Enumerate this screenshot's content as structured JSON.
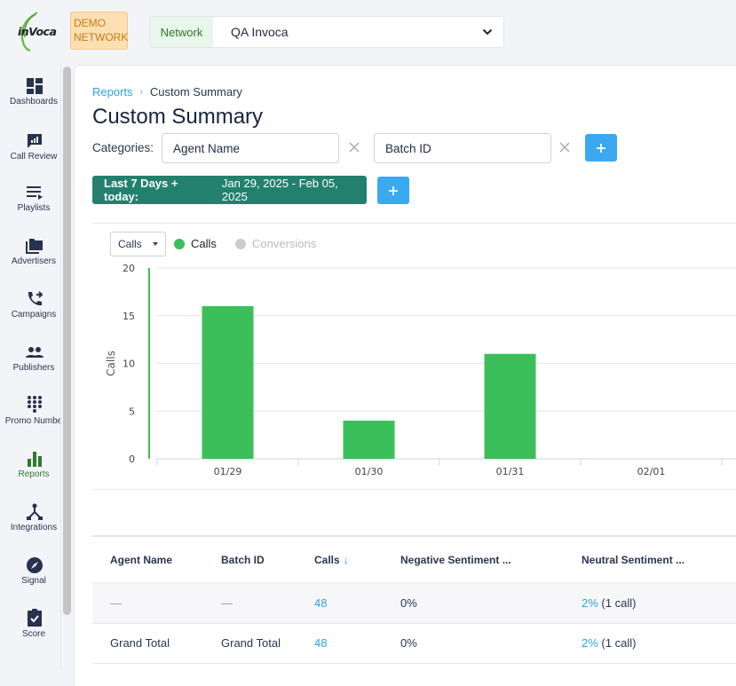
{
  "header": {
    "logo_text": "inVoca",
    "demo_badge": "DEMO NETWORK",
    "network_label": "Network",
    "network_value": "QA Invoca"
  },
  "sidebar": {
    "items": [
      {
        "label": "Dashboards",
        "icon": "dashboard-icon",
        "active": false
      },
      {
        "label": "Call Review",
        "icon": "call-review-icon",
        "active": false
      },
      {
        "label": "Playlists",
        "icon": "playlist-icon",
        "active": false
      },
      {
        "label": "Advertisers",
        "icon": "folder-icon",
        "active": false
      },
      {
        "label": "Campaigns",
        "icon": "phone-forward-icon",
        "active": false
      },
      {
        "label": "Publishers",
        "icon": "people-icon",
        "active": false
      },
      {
        "label": "Promo Numbe",
        "icon": "dialpad-icon",
        "active": false
      },
      {
        "label": "Reports",
        "icon": "bar-chart-icon",
        "active": true
      },
      {
        "label": "Integrations",
        "icon": "integrations-icon",
        "active": false
      },
      {
        "label": "Signal",
        "icon": "compass-icon",
        "active": false
      },
      {
        "label": "Score",
        "icon": "clipboard-check-icon",
        "active": false
      }
    ]
  },
  "breadcrumb": {
    "parent": "Reports",
    "separator": "›",
    "current": "Custom Summary"
  },
  "page_title": "Custom Summary",
  "categories": {
    "label": "Categories:",
    "values": [
      "Agent Name",
      "Batch ID"
    ]
  },
  "date_range": {
    "preset": "Last 7 Days + today:",
    "range": "Jan 29, 2025 - Feb 05, 2025"
  },
  "chart_controls": {
    "metric_select": "Calls",
    "legend": [
      {
        "label": "Calls",
        "color": "#3bbf5a",
        "active": true
      },
      {
        "label": "Conversions",
        "color": "#cccccc",
        "active": false
      }
    ]
  },
  "chart_data": {
    "type": "bar",
    "title": "",
    "xlabel": "",
    "ylabel": "Calls",
    "categories": [
      "01/29",
      "01/30",
      "01/31",
      "02/01"
    ],
    "values": [
      16,
      4,
      11,
      0
    ],
    "ylim": [
      0,
      20
    ],
    "yticks": [
      0,
      5,
      10,
      15,
      20
    ],
    "grid": true,
    "bar_color": "#3bbf5a"
  },
  "table": {
    "columns": [
      "Agent Name",
      "Batch ID",
      "Calls",
      "Negative Sentiment ...",
      "Neutral Sentiment ..."
    ],
    "sort_column": "Calls",
    "sort_direction": "desc",
    "rows": [
      {
        "agent": "—",
        "batch": "—",
        "calls": "48",
        "negative": "0%",
        "neutral_pct": "2%",
        "neutral_count": "(1 call)"
      },
      {
        "agent": "Grand Total",
        "batch": "Grand Total",
        "calls": "48",
        "negative": "0%",
        "neutral_pct": "2%",
        "neutral_count": "(1 call)"
      }
    ]
  },
  "colors": {
    "accent_blue": "#3aa9ef",
    "link_blue": "#2ea2e6",
    "date_button": "#23806f",
    "active_nav": "#2d7a2d",
    "bar_green": "#3bbf5a"
  }
}
